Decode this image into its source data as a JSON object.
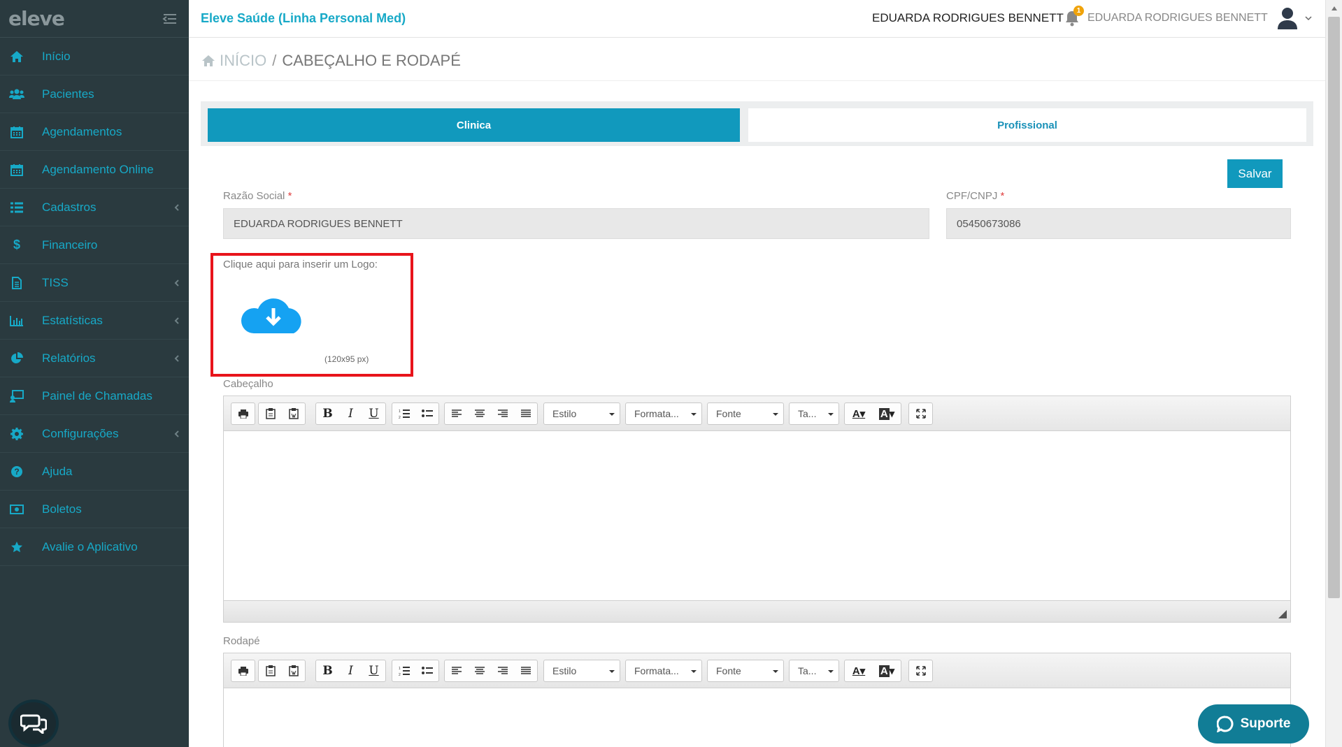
{
  "sidebar": {
    "logo": "eleve",
    "items": [
      {
        "label": "Início",
        "icon": "home-icon",
        "has_submenu": false
      },
      {
        "label": "Pacientes",
        "icon": "users-icon",
        "has_submenu": false
      },
      {
        "label": "Agendamentos",
        "icon": "calendar-icon",
        "has_submenu": false
      },
      {
        "label": "Agendamento Online",
        "icon": "calendar-icon",
        "has_submenu": false
      },
      {
        "label": "Cadastros",
        "icon": "list-icon",
        "has_submenu": true
      },
      {
        "label": "Financeiro",
        "icon": "dollar-icon",
        "has_submenu": false
      },
      {
        "label": "TISS",
        "icon": "document-icon",
        "has_submenu": true
      },
      {
        "label": "Estatísticas",
        "icon": "bar-chart-icon",
        "has_submenu": true
      },
      {
        "label": "Relatórios",
        "icon": "pie-chart-icon",
        "has_submenu": true
      },
      {
        "label": "Painel de Chamadas",
        "icon": "monitor-icon",
        "has_submenu": false
      },
      {
        "label": "Configurações",
        "icon": "gear-icon",
        "has_submenu": true
      },
      {
        "label": "Ajuda",
        "icon": "question-icon",
        "has_submenu": false
      },
      {
        "label": "Boletos",
        "icon": "money-icon",
        "has_submenu": false
      },
      {
        "label": "Avalie o Aplicativo",
        "icon": "star-icon",
        "has_submenu": false
      }
    ]
  },
  "header": {
    "app_title": "Eleve Saúde (Linha Personal Med)",
    "user_name": "EDUARDA RODRIGUES BENNETT",
    "notification_count": "1",
    "user_menu_name": "EDUARDA RODRIGUES BENNETT"
  },
  "breadcrumb": {
    "home": "INÍCIO",
    "separator": "/",
    "current": "CABEÇALHO E RODAPÉ"
  },
  "tabs": {
    "clinica": "Clinica",
    "profissional": "Profissional"
  },
  "form": {
    "save_label": "Salvar",
    "razao_social_label": "Razão Social",
    "razao_social_value": "EDUARDA RODRIGUES BENNETT",
    "cpf_cnpj_label": "CPF/CNPJ",
    "cpf_cnpj_value": "05450673086",
    "required_mark": "*",
    "logo_prompt": "Clique aqui para inserir um Logo:",
    "logo_size": "(120x95 px)",
    "header_label": "Cabeçalho",
    "footer_label": "Rodapé"
  },
  "editor": {
    "style_label": "Estilo",
    "format_label": "Formata...",
    "font_label": "Fonte",
    "size_label": "Ta...",
    "bold": "B",
    "italic": "I",
    "underline": "U",
    "text_color": "A",
    "bg_color": "A"
  },
  "support_label": "Suporte",
  "colors": {
    "sidebar_bg": "#2a3a3f",
    "accent": "#1199bd",
    "sidebar_text": "#17a9c7",
    "highlight_border": "#e8141b"
  }
}
